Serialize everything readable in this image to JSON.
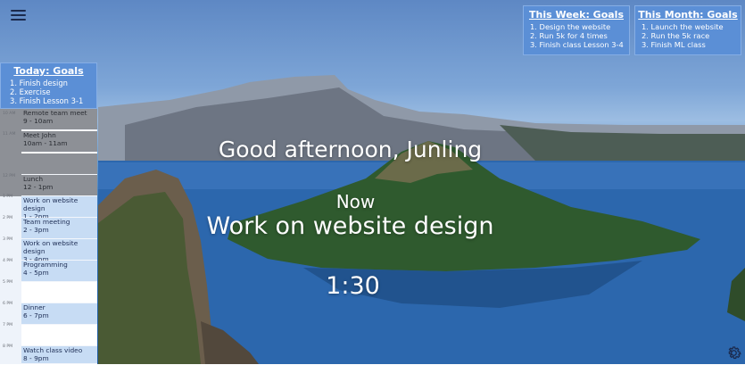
{
  "menu": {
    "icon": "hamburger-menu-icon"
  },
  "week_goals": {
    "title": "This Week: Goals",
    "items": [
      "1. Design the website",
      "2. Run 5k for 4 times",
      "3. Finish class Lesson 3-4"
    ]
  },
  "month_goals": {
    "title": "This Month: Goals",
    "items": [
      "1. Launch the website",
      "2. Run the 5k race",
      "3. Finish ML class"
    ]
  },
  "today_goals": {
    "title": "Today: Goals",
    "items": [
      "1. Finish design",
      "2. Exercise",
      "3. Finish Lesson 3-1"
    ]
  },
  "schedule": {
    "time_labels": [
      "10 AM",
      "11 AM",
      "12 PM",
      "1 PM",
      "2 PM",
      "3 PM",
      "4 PM",
      "5 PM",
      "6 PM",
      "7 PM",
      "8 PM"
    ],
    "events": [
      {
        "title": "Remote team meet",
        "time": "9 - 10am",
        "state": "past"
      },
      {
        "title": "Meet John",
        "time": "10am - 11am",
        "state": "past"
      },
      {
        "title": "",
        "time": "",
        "state": "past"
      },
      {
        "title": "Lunch",
        "time": "12 - 1pm",
        "state": "past"
      },
      {
        "title": "Work on website design",
        "time": "1 - 2pm",
        "state": "future"
      },
      {
        "title": "Team meeting",
        "time": "2 - 3pm",
        "state": "future"
      },
      {
        "title": "Work on website design",
        "time": "3 - 4pm",
        "state": "future"
      },
      {
        "title": "Programming",
        "time": "4 - 5pm",
        "state": "future"
      },
      {
        "title": "",
        "time": "",
        "state": "empty"
      },
      {
        "title": "Dinner",
        "time": "6 - 7pm",
        "state": "future"
      },
      {
        "title": "",
        "time": "",
        "state": "empty"
      },
      {
        "title": "Watch class video",
        "time": "8 - 9pm",
        "state": "future"
      }
    ]
  },
  "main": {
    "greeting": "Good afternoon, Junling",
    "now_label": "Now",
    "current_task": "Work on website design",
    "timer": "1:30"
  },
  "settings": {
    "icon": "gear-icon"
  },
  "colors": {
    "card_bg": "#5b8fd6",
    "past_event": "#8d9096",
    "future_event": "#c7dcf4",
    "text_white": "#ffffff"
  }
}
